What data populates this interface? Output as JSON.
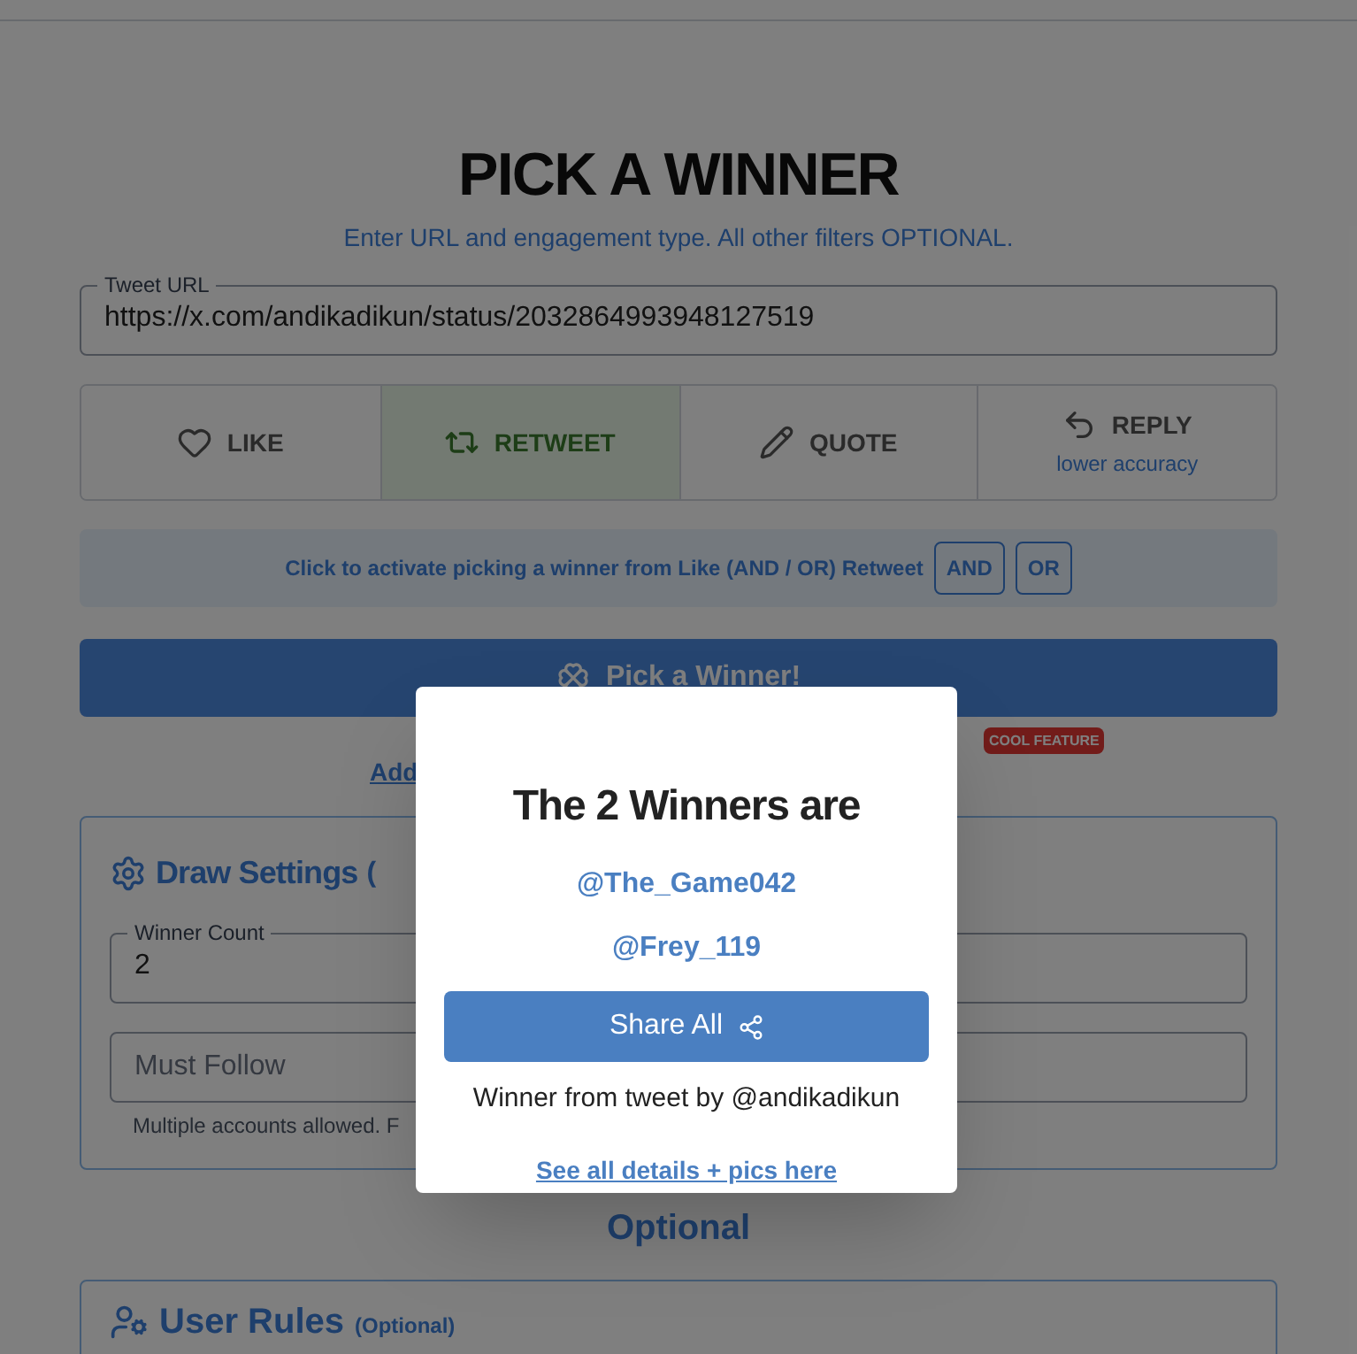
{
  "header": {
    "title": "PICK A WINNER",
    "subtitle": "Enter URL and engagement type. All other filters OPTIONAL."
  },
  "tweet_url": {
    "label": "Tweet URL",
    "value": "https://x.com/andikadikun/status/2032864993948127519"
  },
  "engagement": [
    {
      "kind": "like",
      "label": "LIKE",
      "selected": false
    },
    {
      "kind": "retweet",
      "label": "RETWEET",
      "selected": true
    },
    {
      "kind": "quote",
      "label": "QUOTE",
      "selected": false
    },
    {
      "kind": "reply",
      "label": "REPLY",
      "note": "lower accuracy",
      "selected": false
    }
  ],
  "combine_bar": {
    "text": "Click to activate picking a winner from Like (AND / OR) Retweet",
    "options": [
      {
        "label": "AND",
        "selected": false
      },
      {
        "label": "OR",
        "selected": false
      }
    ]
  },
  "pick_button": {
    "label": "Pick a Winner!"
  },
  "add_link": {
    "label": "Add",
    "badge": "COOL FEATURE"
  },
  "draw_settings": {
    "title": "Draw Settings",
    "title_suffix": "(",
    "winner_count": {
      "label": "Winner Count",
      "value": "2"
    },
    "must_follow": {
      "placeholder": "Must Follow",
      "hint": "Multiple accounts allowed. F"
    }
  },
  "optional_heading": "Optional",
  "user_rules": {
    "title": "User Rules",
    "suffix": "(Optional)"
  },
  "modal": {
    "title": "The 2 Winners are",
    "winners": [
      "@The_Game042",
      "@Frey_119"
    ],
    "share_button": "Share All",
    "source": "Winner from tweet by @andikadikun",
    "details_link": "See all details + pics here"
  }
}
